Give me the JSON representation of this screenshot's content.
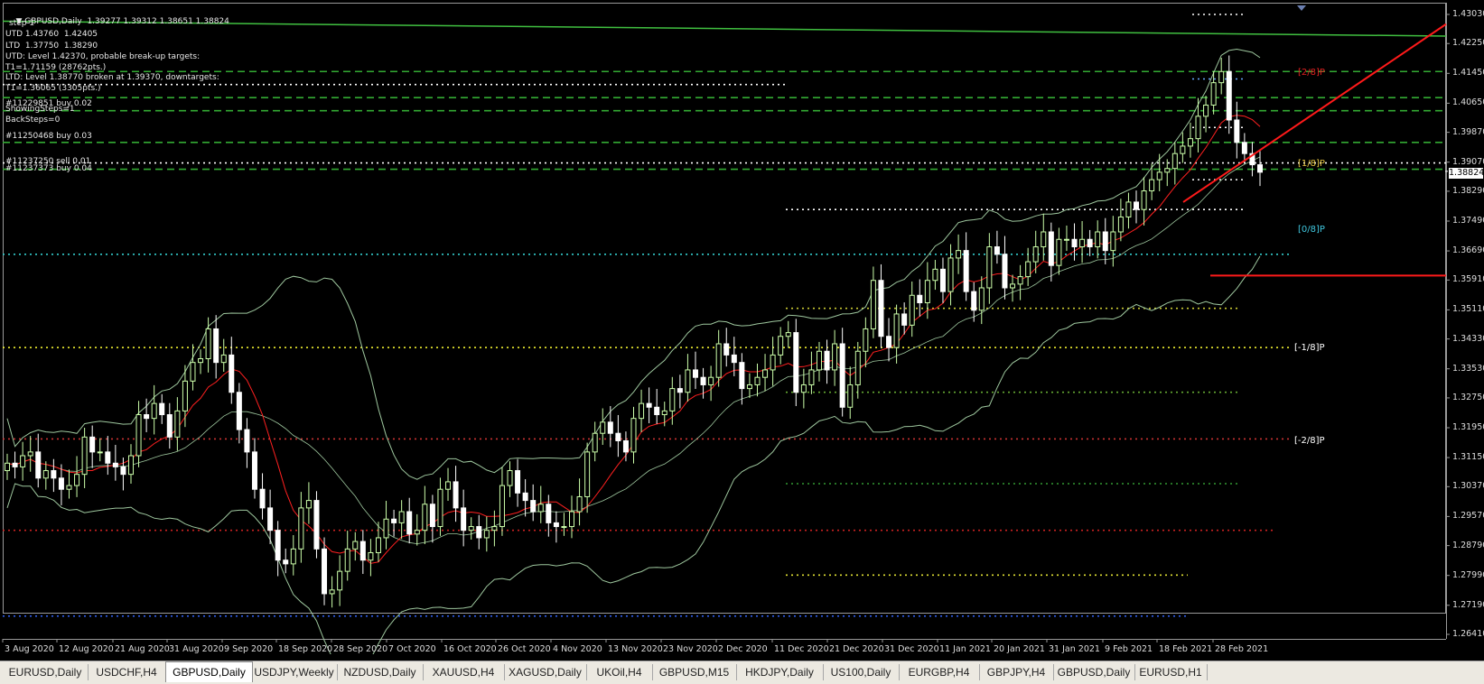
{
  "header": {
    "symbol": "GBPUSD,Daily",
    "ohlc": "1.39277 1.39312 1.38651 1.38824"
  },
  "info_lines": [
    "step 1",
    "UTD 1.43760  1.42405",
    "LTD  1.37750  1.38290",
    "UTD: Level 1.42370, probable break-up targets:",
    "T1=1.71159 (28762pts.)",
    "LTD: Level 1.38770 broken at 1.39370, downtargets:",
    "T1=1.36065 (3305pts.)",
    "#11229851 buy 0.02",
    "ShowingSteps=1",
    "BackSteps=0",
    "#11250468 buy 0.03",
    "#11237250 sell 0.01",
    "#11237373 buy 0.04"
  ],
  "murrey_labels": [
    "[2/8]P",
    "[1/8]P",
    "[0/8]P",
    "[-1/8]P",
    "[-2/8]P"
  ],
  "price_axis": [
    "1.43030",
    "1.42250",
    "1.41450",
    "1.40650",
    "1.39870",
    "1.39070",
    "1.38290",
    "1.37490",
    "1.36690",
    "1.35910",
    "1.35110",
    "1.34330",
    "1.33530",
    "1.32750",
    "1.31950",
    "1.31150",
    "1.30370",
    "1.29570",
    "1.28790",
    "1.27990",
    "1.27190",
    "1.26410"
  ],
  "current_price": "1.38824",
  "date_axis": [
    "3 Aug 2020",
    "12 Aug 2020",
    "21 Aug 2020",
    "31 Aug 2020",
    "9 Sep 2020",
    "18 Sep 2020",
    "28 Sep 2020",
    "7 Oct 2020",
    "16 Oct 2020",
    "26 Oct 2020",
    "4 Nov 2020",
    "13 Nov 2020",
    "23 Nov 2020",
    "2 Dec 2020",
    "11 Dec 2020",
    "21 Dec 2020",
    "31 Dec 2020",
    "11 Jan 2021",
    "20 Jan 2021",
    "31 Jan 2021",
    "9 Feb 2021",
    "18 Feb 2021",
    "28 Feb 2021"
  ],
  "tabs": [
    {
      "label": "EURUSD,Daily",
      "active": false
    },
    {
      "label": "USDCHF,H4",
      "active": false
    },
    {
      "label": "GBPUSD,Daily",
      "active": true
    },
    {
      "label": "USDJPY,Weekly",
      "active": false
    },
    {
      "label": "NZDUSD,Daily",
      "active": false
    },
    {
      "label": "XAUUSD,H4",
      "active": false
    },
    {
      "label": "XAGUSD,Daily",
      "active": false
    },
    {
      "label": "UKOil,H4",
      "active": false
    },
    {
      "label": "GBPUSD,M15",
      "active": false
    },
    {
      "label": "HKDJPY,Daily",
      "active": false
    },
    {
      "label": "US100,Daily",
      "active": false
    },
    {
      "label": "EURGBP,H4",
      "active": false
    },
    {
      "label": "GBPJPY,H4",
      "active": false
    },
    {
      "label": "GBPUSD,Daily",
      "active": false
    },
    {
      "label": "EURUSD,H1",
      "active": false
    }
  ],
  "colors": {
    "bull_candle": "#ccffaa",
    "bear_candle": "#ffffff",
    "band": "#9ec79e",
    "ma_red": "#ff2020",
    "trendline": "#ff1a1a",
    "channel_green": "#40c040",
    "current_price_tag": "#ffffff"
  },
  "chart_data": {
    "type": "candlestick",
    "symbol": "GBPUSD",
    "timeframe": "Daily",
    "ylim": [
      1.2641,
      1.4303
    ],
    "current": {
      "open": 1.39277,
      "high": 1.39312,
      "low": 1.38651,
      "close": 1.38824
    },
    "date_ticks": [
      "3 Aug 2020",
      "12 Aug 2020",
      "21 Aug 2020",
      "31 Aug 2020",
      "9 Sep 2020",
      "18 Sep 2020",
      "28 Sep 2020",
      "7 Oct 2020",
      "16 Oct 2020",
      "26 Oct 2020",
      "4 Nov 2020",
      "13 Nov 2020",
      "23 Nov 2020",
      "2 Dec 2020",
      "11 Dec 2020",
      "21 Dec 2020",
      "31 Dec 2020",
      "11 Jan 2021",
      "20 Jan 2021",
      "31 Jan 2021",
      "9 Feb 2021",
      "18 Feb 2021",
      "28 Feb 2021"
    ],
    "closes": [
      1.31,
      1.309,
      1.312,
      1.313,
      1.306,
      1.308,
      1.306,
      1.303,
      1.304,
      1.307,
      1.317,
      1.313,
      1.313,
      1.31,
      1.309,
      1.307,
      1.312,
      1.323,
      1.322,
      1.326,
      1.323,
      1.317,
      1.324,
      1.332,
      1.337,
      1.338,
      1.346,
      1.337,
      1.339,
      1.329,
      1.319,
      1.313,
      1.303,
      1.298,
      1.292,
      1.284,
      1.283,
      1.287,
      1.298,
      1.3,
      1.287,
      1.275,
      1.276,
      1.281,
      1.287,
      1.289,
      1.284,
      1.286,
      1.29,
      1.295,
      1.294,
      1.297,
      1.291,
      1.292,
      1.299,
      1.293,
      1.303,
      1.305,
      1.298,
      1.292,
      1.293,
      1.29,
      1.292,
      1.293,
      1.304,
      1.308,
      1.302,
      1.3,
      1.297,
      1.299,
      1.294,
      1.293,
      1.293,
      1.297,
      1.301,
      1.313,
      1.318,
      1.321,
      1.318,
      1.316,
      1.313,
      1.322,
      1.326,
      1.325,
      1.323,
      1.324,
      1.33,
      1.329,
      1.335,
      1.333,
      1.331,
      1.333,
      1.342,
      1.339,
      1.337,
      1.33,
      1.331,
      1.333,
      1.335,
      1.339,
      1.344,
      1.345,
      1.329,
      1.331,
      1.335,
      1.34,
      1.335,
      1.342,
      1.325,
      1.331,
      1.34,
      1.346,
      1.359,
      1.344,
      1.341,
      1.35,
      1.347,
      1.355,
      1.353,
      1.359,
      1.362,
      1.356,
      1.365,
      1.367,
      1.356,
      1.351,
      1.357,
      1.368,
      1.366,
      1.357,
      1.358,
      1.36,
      1.364,
      1.368,
      1.372,
      1.363,
      1.37,
      1.37,
      1.368,
      1.37,
      1.368,
      1.372,
      1.367,
      1.372,
      1.376,
      1.38,
      1.378,
      1.383,
      1.386,
      1.388,
      1.389,
      1.393,
      1.395,
      1.397,
      1.403,
      1.406,
      1.412,
      1.415,
      1.402,
      1.396,
      1.393,
      1.39,
      1.388
    ]
  }
}
